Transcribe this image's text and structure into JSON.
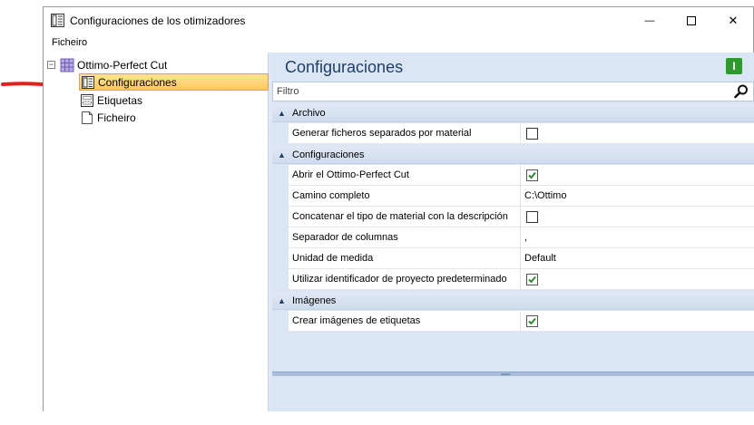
{
  "window": {
    "title": "Configuraciones de los otimizadores",
    "minimize_glyph": "—",
    "maximize_glyph": "☐",
    "close_glyph": "✕"
  },
  "menu": {
    "items": [
      "Ficheiro"
    ]
  },
  "tree": {
    "root": {
      "label": "Ottimo-Perfect Cut",
      "icon": "grid-table-icon",
      "expanded_glyph": "−"
    },
    "children": [
      {
        "label": "Configuraciones",
        "icon": "config-sheet-icon",
        "selected": true
      },
      {
        "label": "Etiquetas",
        "icon": "label-sheet-icon",
        "selected": false
      },
      {
        "label": "Ficheiro",
        "icon": "file-icon",
        "selected": false
      }
    ]
  },
  "panel": {
    "title": "Configuraciones",
    "info_glyph": "I",
    "filter_placeholder": "Filtro"
  },
  "sections": [
    {
      "label": "Archivo",
      "rows": [
        {
          "name": "Generar ficheros separados por material",
          "type": "checkbox",
          "checked": false
        }
      ]
    },
    {
      "label": "Configuraciones",
      "rows": [
        {
          "name": "Abrir el Ottimo-Perfect Cut",
          "type": "checkbox",
          "checked": true
        },
        {
          "name": "Camino completo",
          "type": "text",
          "value": "C:\\Ottimo"
        },
        {
          "name": "Concatenar el tipo de material con la descripción",
          "type": "checkbox",
          "checked": false
        },
        {
          "name": "Separador de columnas",
          "type": "text",
          "value": ","
        },
        {
          "name": "Unidad de medida",
          "type": "text",
          "value": "Default"
        },
        {
          "name": "Utilizar identificador de proyecto predeterminado",
          "type": "checkbox",
          "checked": true
        }
      ]
    },
    {
      "label": "Imágenes",
      "rows": [
        {
          "name": "Crear imágenes de etiquetas",
          "type": "checkbox",
          "checked": true
        }
      ]
    }
  ],
  "colors": {
    "accent_arrow": "#e0201c",
    "selection": "#ffc95a",
    "panel_bg": "#dbe6f4",
    "title_text": "#1e3e6a",
    "check_green": "#2f8a2f"
  }
}
